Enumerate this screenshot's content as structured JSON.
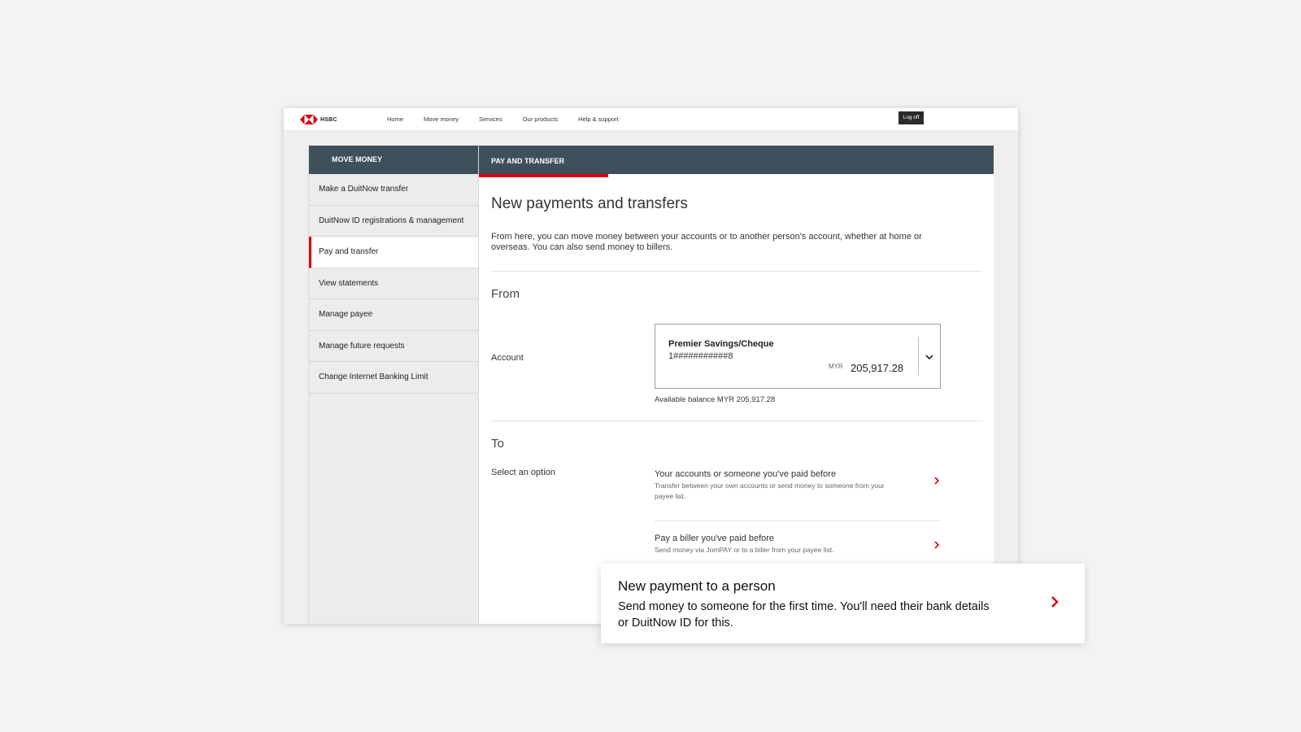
{
  "brand": {
    "name": "HSBC",
    "red": "#db0011",
    "dark": "#3e505c"
  },
  "topnav": {
    "links": [
      "Home",
      "Move money",
      "Services",
      "Our products",
      "Help & support"
    ],
    "logoff": "Log off"
  },
  "sidebar": {
    "heading": "MOVE MONEY",
    "items": [
      {
        "label": "Make a DuitNow transfer"
      },
      {
        "label": "DuitNow ID registrations & management"
      },
      {
        "label": "Pay and transfer",
        "active": true
      },
      {
        "label": "View statements"
      },
      {
        "label": "Manage payee"
      },
      {
        "label": "Manage future requests"
      },
      {
        "label": "Change Internet Banking Limit"
      }
    ]
  },
  "content": {
    "tab": "PAY AND TRANSFER",
    "title": "New payments and transfers",
    "intro": "From here, you can move money between your accounts or to another person's account, whether at home or overseas. You can also send money to billers.",
    "from": {
      "heading": "From",
      "label": "Account",
      "account_name": "Premier Savings/Cheque",
      "account_number": "1###########8",
      "currency": "MYR",
      "amount": "205,917.28",
      "available": "Available balance MYR 205,917.28"
    },
    "to": {
      "heading": "To",
      "label": "Select an option",
      "options": [
        {
          "title": "Your accounts or someone you've paid before",
          "desc": "Transfer between your own accounts or send money to someone from your payee list."
        },
        {
          "title": "Pay a biller you've paid before",
          "desc": "Send money via JomPAY or to a biller from your payee list."
        }
      ]
    }
  },
  "popout": {
    "title": "New payment to a person",
    "desc": "Send money to someone for the first time. You'll need their bank details or DuitNow ID for this."
  }
}
